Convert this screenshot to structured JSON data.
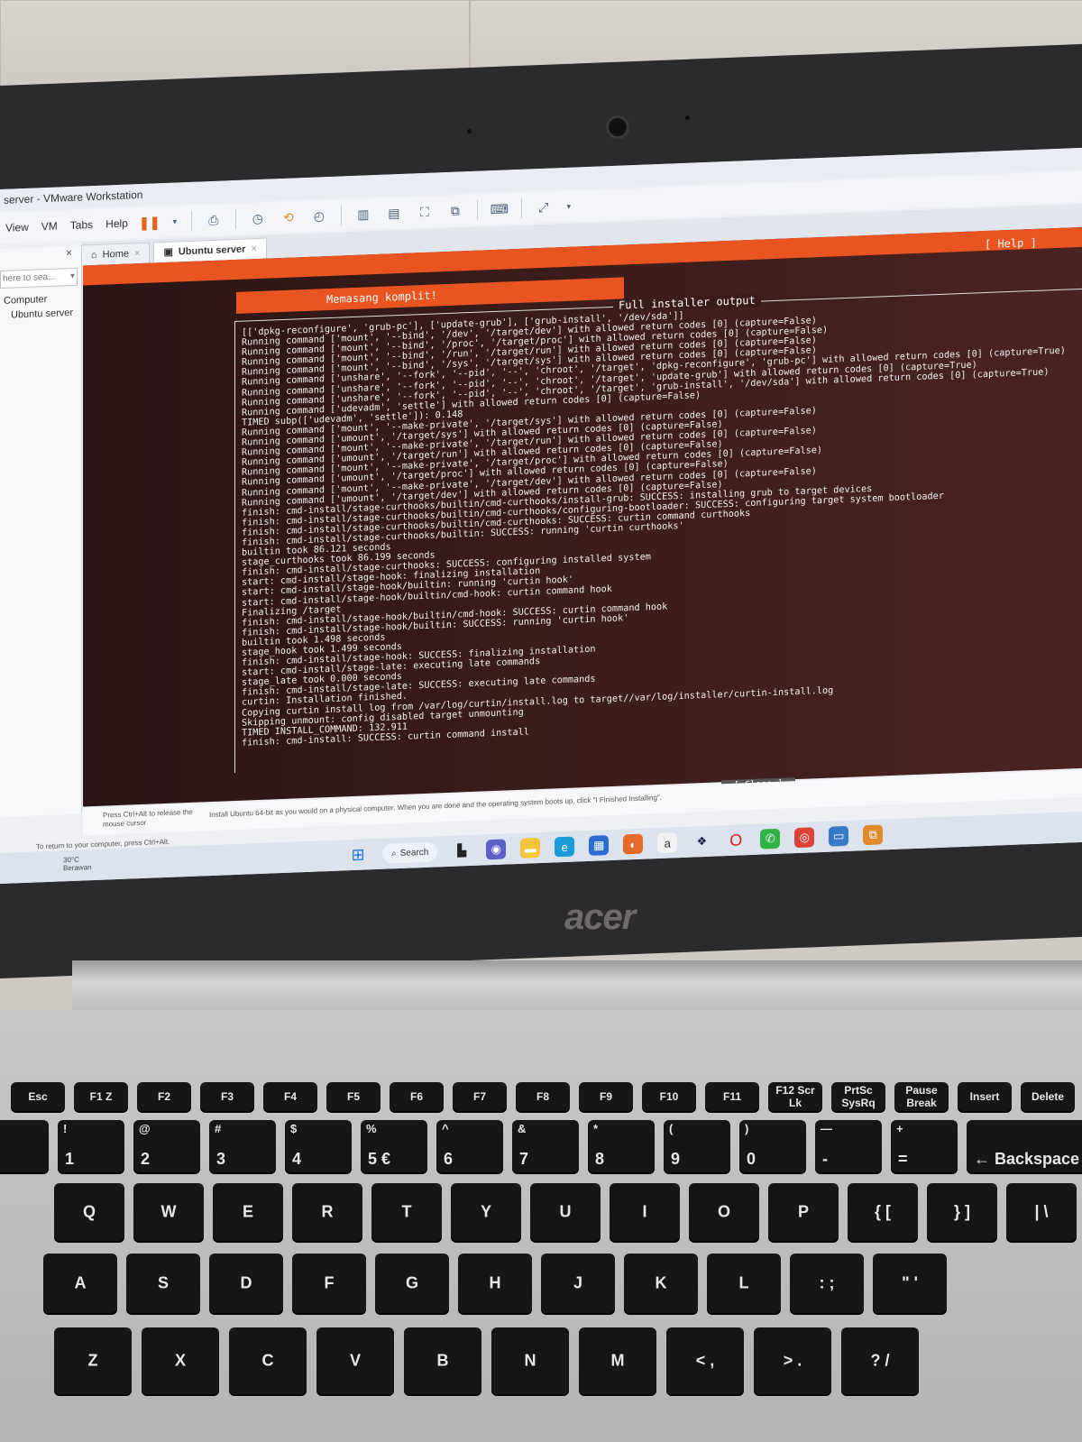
{
  "window": {
    "title": "server - VMware Workstation",
    "menu": [
      "View",
      "VM",
      "Tabs",
      "Help"
    ]
  },
  "sidebar": {
    "search_placeholder": "here to sea...",
    "items": [
      "Computer",
      "Ubuntu server"
    ]
  },
  "tabs": [
    {
      "label": "Home"
    },
    {
      "label": "Ubuntu server"
    }
  ],
  "installer": {
    "help_label": "[ Help ]",
    "title": "Memasang komplit!",
    "panel_title": "Full installer output",
    "close_label": "[ Close     ]",
    "log_lines": [
      "[['dpkg-reconfigure', 'grub-pc'], ['update-grub'], ['grub-install', '/dev/sda']]",
      "Running command ['mount', '--bind', '/dev', '/target/dev'] with allowed return codes [0] (capture=False)",
      "Running command ['mount', '--bind', '/proc', '/target/proc'] with allowed return codes [0] (capture=False)",
      "Running command ['mount', '--bind', '/run', '/target/run'] with allowed return codes [0] (capture=False)",
      "Running command ['mount', '--bind', '/sys', '/target/sys'] with allowed return codes [0] (capture=False)",
      "Running command ['unshare', '--fork', '--pid', '--', 'chroot', '/target', 'dpkg-reconfigure', 'grub-pc'] with allowed return codes [0] (capture=True)",
      "Running command ['unshare', '--fork', '--pid', '--', 'chroot', '/target', 'update-grub'] with allowed return codes [0] (capture=True)",
      "Running command ['unshare', '--fork', '--pid', '--', 'chroot', '/target', 'grub-install', '/dev/sda'] with allowed return codes [0] (capture=True)",
      "Running command ['udevadm', 'settle'] with allowed return codes [0] (capture=False)",
      "TIMED subp(['udevadm', 'settle']): 0.148",
      "Running command ['mount', '--make-private', '/target/sys'] with allowed return codes [0] (capture=False)",
      "Running command ['umount', '/target/sys'] with allowed return codes [0] (capture=False)",
      "Running command ['mount', '--make-private', '/target/run'] with allowed return codes [0] (capture=False)",
      "Running command ['umount', '/target/run'] with allowed return codes [0] (capture=False)",
      "Running command ['mount', '--make-private', '/target/proc'] with allowed return codes [0] (capture=False)",
      "Running command ['umount', '/target/proc'] with allowed return codes [0] (capture=False)",
      "Running command ['mount', '--make-private', '/target/dev'] with allowed return codes [0] (capture=False)",
      "Running command ['umount', '/target/dev'] with allowed return codes [0] (capture=False)",
      "finish: cmd-install/stage-curthooks/builtin/cmd-curthooks/install-grub: SUCCESS: installing grub to target devices",
      "finish: cmd-install/stage-curthooks/builtin/cmd-curthooks/configuring-bootloader: SUCCESS: configuring target system bootloader",
      "finish: cmd-install/stage-curthooks/builtin/cmd-curthooks: SUCCESS: curtin command curthooks",
      "finish: cmd-install/stage-curthooks/builtin: SUCCESS: running 'curtin curthooks'",
      "builtin took 86.121 seconds",
      "stage_curthooks took 86.199 seconds",
      "finish: cmd-install/stage-curthooks: SUCCESS: configuring installed system",
      "start: cmd-install/stage-hook: finalizing installation",
      "start: cmd-install/stage-hook/builtin: running 'curtin hook'",
      "start: cmd-install/stage-hook/builtin/cmd-hook: curtin command hook",
      "Finalizing /target",
      "finish: cmd-install/stage-hook/builtin/cmd-hook: SUCCESS: curtin command hook",
      "finish: cmd-install/stage-hook/builtin: SUCCESS: running 'curtin hook'",
      "builtin took 1.498 seconds",
      "stage_hook took 1.499 seconds",
      "finish: cmd-install/stage-hook: SUCCESS: finalizing installation",
      "start: cmd-install/stage-late: executing late commands",
      "stage_late took 0.000 seconds",
      "finish: cmd-install/stage-late: SUCCESS: executing late commands",
      "curtin: Installation finished.",
      "Copying curtin install log from /var/log/curtin/install.log to target//var/log/installer/curtin-install.log",
      "Skipping unmount: config disabled target unmounting",
      "TIMED INSTALL_COMMAND: 132.911",
      "finish: cmd-install: SUCCESS: curtin command install"
    ]
  },
  "hint": {
    "cursor_hint": "Press Ctrl+Alt to release the mouse cursor",
    "message": "Install Ubuntu 64-bit as you would on a physical computer. When you are done and the operating system boots up, click \"I Finished Installing\".",
    "status": "To return to your computer, press Ctrl+Alt."
  },
  "taskbar": {
    "weather_temp": "30°C",
    "weather_desc": "Berawan",
    "search_label": "Search"
  },
  "laptop": {
    "brand": "acer"
  },
  "keyboard": {
    "row_fn": [
      {
        "c": "Esc"
      },
      {
        "c": "F1 Z"
      },
      {
        "c": "F2"
      },
      {
        "c": "F3"
      },
      {
        "c": "F4"
      },
      {
        "c": "F5"
      },
      {
        "c": "F6"
      },
      {
        "c": "F7"
      },
      {
        "c": "F8"
      },
      {
        "c": "F9"
      },
      {
        "c": "F10"
      },
      {
        "c": "F11"
      },
      {
        "c": "F12 Scr Lk"
      },
      {
        "c": "PrtSc SysRq"
      },
      {
        "c": "Pause Break"
      },
      {
        "c": "Insert"
      },
      {
        "c": "Delete"
      }
    ],
    "row_num": [
      {
        "t": "~",
        "b": ""
      },
      {
        "t": "!",
        "b": "1"
      },
      {
        "t": "@",
        "b": "2"
      },
      {
        "t": "#",
        "b": "3"
      },
      {
        "t": "$",
        "b": "4"
      },
      {
        "t": "%",
        "b": "5 €"
      },
      {
        "t": "^",
        "b": "6"
      },
      {
        "t": "&",
        "b": "7"
      },
      {
        "t": "*",
        "b": "8"
      },
      {
        "t": "(",
        "b": "9"
      },
      {
        "t": ")",
        "b": "0"
      },
      {
        "t": "—",
        "b": "-"
      },
      {
        "t": "+",
        "b": "="
      },
      {
        "t": "",
        "b": "← Backspace"
      }
    ],
    "row_q": [
      "Q",
      "W",
      "E",
      "R",
      "T",
      "Y",
      "U",
      "I",
      "O",
      "P",
      "{ [",
      "} ]",
      "| \\"
    ],
    "row_a": [
      "A",
      "S",
      "D",
      "F",
      "G",
      "H",
      "J",
      "K",
      "L",
      ": ;",
      "\" '"
    ],
    "row_z": [
      "Z",
      "X",
      "C",
      "V",
      "B",
      "N",
      "M",
      "< ,",
      "> .",
      "? /"
    ]
  }
}
